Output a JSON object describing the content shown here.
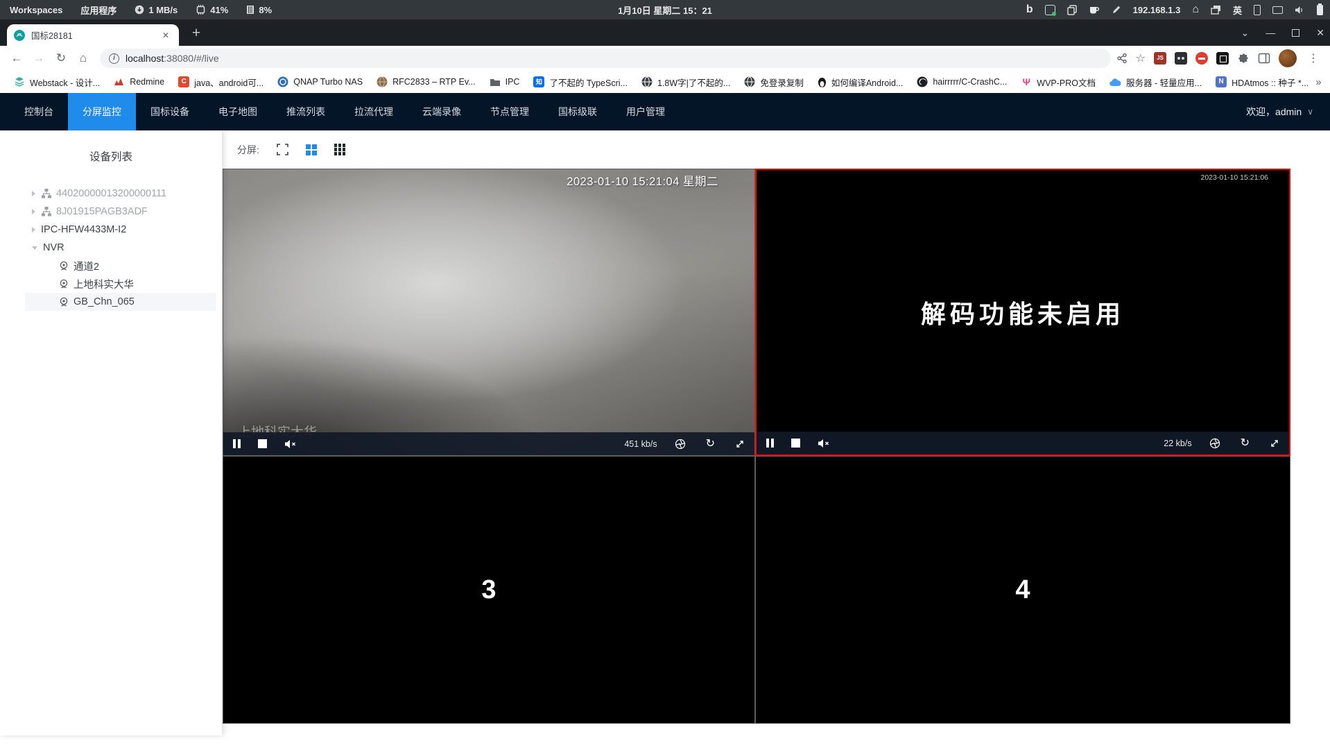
{
  "colors": {
    "accent_blue": "#1f8ceb",
    "nav_background": "#041528",
    "selected_cell_outline": "#fe0000",
    "tab_favicon_teal": "#11a0a0",
    "sysbar_background": "#33383d"
  },
  "system_bar": {
    "workspaces": "Workspaces",
    "applications": "应用程序",
    "net_speed": "1 MB/s",
    "cpu": "41%",
    "memory": "8%",
    "clock": "1月10日 星期二 15：21",
    "ip": "192.168.1.3",
    "input_method": "英"
  },
  "glyphs": {
    "back": "←",
    "forward": "→",
    "reload": "↻",
    "home": "⌂",
    "star": "☆",
    "kebab": "⋮",
    "plus": "+",
    "close": "✕",
    "tab_menu": "⌄",
    "win_min": "—",
    "win_close": "✕",
    "welcome_caret": "∨",
    "info": "i",
    "bing": "b",
    "refresh_player": "↻",
    "overflow": "»"
  },
  "browser": {
    "tab": {
      "title": "国标28181"
    },
    "url": {
      "host": "localhost",
      "rest": ":38080/#/live"
    },
    "bookmarks": [
      {
        "label": "Webstack - 设计..."
      },
      {
        "label": "Redmine"
      },
      {
        "label": "java、android可...",
        "glyph": "C",
        "color": "#e0492e"
      },
      {
        "label": "QNAP Turbo NAS"
      },
      {
        "label": "RFC2833 – RTP Ev..."
      },
      {
        "label": "IPC"
      },
      {
        "label": "了不起的 TypeScri...",
        "glyph": "知",
        "color": "#0a6fe8"
      },
      {
        "label": "1.8W字|了不起的..."
      },
      {
        "label": "免登录复制"
      },
      {
        "label": "如何编译Android..."
      },
      {
        "label": "hairrrrr/C-CrashC..."
      },
      {
        "label": "WVP-PRO文档",
        "glyph": "Ψ",
        "color": "#e0417f"
      },
      {
        "label": "服务器 - 轻量应用..."
      },
      {
        "label": "HDAtmos :: 种子 *...",
        "glyph": "N",
        "color": "#4f74c9"
      }
    ]
  },
  "nav": {
    "items": [
      {
        "label": "控制台"
      },
      {
        "label": "分屏监控",
        "active": true
      },
      {
        "label": "国标设备"
      },
      {
        "label": "电子地图"
      },
      {
        "label": "推流列表"
      },
      {
        "label": "拉流代理"
      },
      {
        "label": "云端录像"
      },
      {
        "label": "节点管理"
      },
      {
        "label": "国标级联"
      },
      {
        "label": "用户管理"
      }
    ],
    "welcome": "欢迎，admin"
  },
  "sidebar": {
    "title": "设备列表",
    "tree": [
      {
        "label": "44020000013200000111",
        "level": 1,
        "icon": "device-cluster",
        "state": "offline"
      },
      {
        "label": "8J01915PAGB3ADF",
        "level": 1,
        "icon": "device-cluster",
        "state": "offline"
      },
      {
        "label": "IPC-HFW4433M-I2",
        "level": 1,
        "icon": "none",
        "state": "online"
      },
      {
        "label": "NVR",
        "level": 1,
        "icon": "none",
        "expanded": true
      },
      {
        "label": "通道2",
        "level": 2,
        "icon": "camera"
      },
      {
        "label": "上地科实大华",
        "level": 2,
        "icon": "camera"
      },
      {
        "label": "GB_Chn_065",
        "level": 2,
        "icon": "camera",
        "selected": true
      }
    ]
  },
  "toolbar": {
    "split_label": "分屏:"
  },
  "players": [
    {
      "id": 1,
      "timestamp": "2023-01-10 15:21:04 星期二",
      "watermark": "上地科实大华",
      "bitrate": "451 kb/s"
    },
    {
      "id": 2,
      "timestamp": "2023-01-10 15:21:06",
      "message": "解码功能未启用",
      "bitrate": "22 kb/s",
      "selected": true
    },
    {
      "id": 3,
      "label": "3"
    },
    {
      "id": 4,
      "label": "4"
    }
  ]
}
